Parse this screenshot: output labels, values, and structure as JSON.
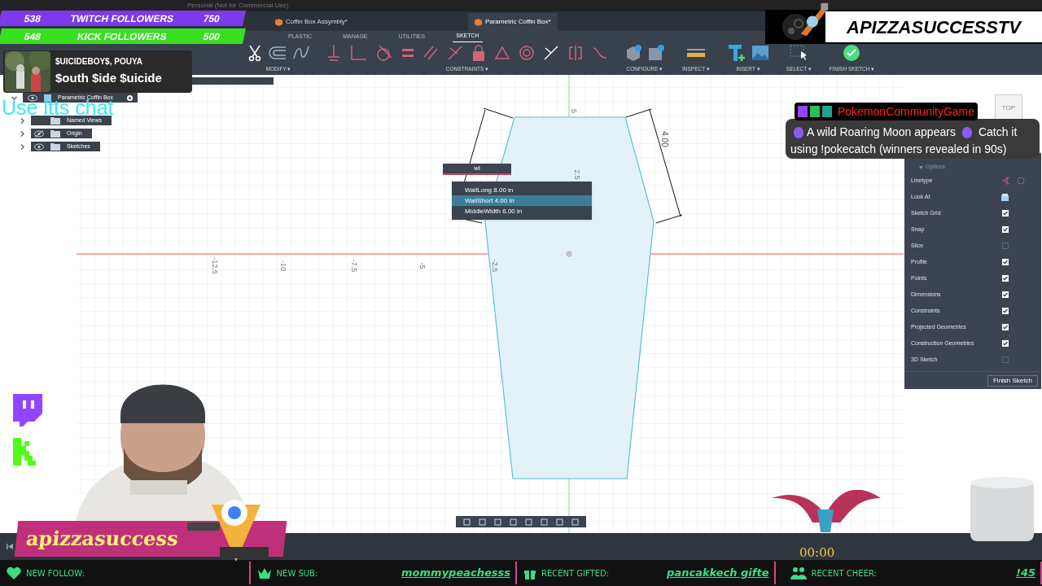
{
  "title_bar": {
    "text": "Personal (Not for Commercial Use)"
  },
  "document_tabs": [
    {
      "label": "Coffin Box Assymbly*",
      "selected": false
    },
    {
      "label": "Parametric Coffin Box*",
      "selected": true
    }
  ],
  "ribbon_tabs": [
    {
      "label": "PLASTIC",
      "selected": false
    },
    {
      "label": "MANAGE",
      "selected": false
    },
    {
      "label": "UTILITIES",
      "selected": false
    },
    {
      "label": "SKETCH",
      "selected": true
    }
  ],
  "ribbon_groups": [
    {
      "label": "MODIFY ▾",
      "kind": "modify"
    },
    {
      "label": "CONSTRAINTS ▾",
      "kind": "constraints"
    },
    {
      "label": "CONFIGURE ▾",
      "kind": "configure"
    },
    {
      "label": "INSPECT ▾",
      "kind": "inspect"
    },
    {
      "label": "INSERT ▾",
      "kind": "insert"
    },
    {
      "label": "SELECT ▾",
      "kind": "select"
    },
    {
      "label": "FINISH SKETCH ▾",
      "kind": "finish"
    }
  ],
  "browser": {
    "root": {
      "label": "Parametric Coffin Box",
      "visible": true,
      "expanded": true,
      "children": [
        {
          "label": "Named Views",
          "expanded": false
        },
        {
          "label": "Origin",
          "visible": false,
          "expanded": false
        },
        {
          "label": "Sketches",
          "visible": true,
          "expanded": false
        }
      ]
    }
  },
  "canvas": {
    "axis_labels": [
      "-12.5",
      "-10",
      "-7.5",
      "-5",
      "-2.5"
    ],
    "vertical_labels": [
      "5",
      "2.5"
    ],
    "dimension": "4.00",
    "search": {
      "value": "wl"
    },
    "suggestions": [
      {
        "name": "WallLong",
        "value": "8.00 in",
        "selected": false
      },
      {
        "name": "WallShort",
        "value": "4.00 in",
        "selected": true
      },
      {
        "name": "MiddleWidth",
        "value": "6.00 in",
        "selected": false
      }
    ]
  },
  "view_cube": {
    "label": "TOP"
  },
  "sketch_palette": {
    "section": "Options",
    "options": [
      {
        "label": "Linetype",
        "kind": "linetype"
      },
      {
        "label": "Look At",
        "kind": "lookat"
      },
      {
        "label": "Sketch Grid",
        "kind": "checkbox",
        "checked": true
      },
      {
        "label": "Snap",
        "kind": "checkbox",
        "checked": true
      },
      {
        "label": "Slice",
        "kind": "checkbox",
        "checked": false
      },
      {
        "label": "Profile",
        "kind": "checkbox",
        "checked": true
      },
      {
        "label": "Points",
        "kind": "checkbox",
        "checked": true
      },
      {
        "label": "Dimensions",
        "kind": "checkbox",
        "checked": true
      },
      {
        "label": "Constraints",
        "kind": "checkbox",
        "checked": true
      },
      {
        "label": "Projected Geometries",
        "kind": "checkbox",
        "checked": true
      },
      {
        "label": "Construction Geometries",
        "kind": "checkbox",
        "checked": true
      },
      {
        "label": "3D Sketch",
        "kind": "checkbox",
        "checked": false
      }
    ],
    "button": "Finish Sketch"
  },
  "timeline": {
    "time": "00:00"
  },
  "overlay": {
    "follower_bars": [
      {
        "current": "538",
        "label": "TWITCH FOLLOWERS",
        "goal": "750",
        "color": "#7c3aed"
      },
      {
        "current": "548",
        "label": "KICK FOLLOWERS",
        "goal": "500",
        "color": "#39e01f"
      }
    ],
    "now_playing": {
      "artist": "$UICIDEBOY$, POUYA",
      "title": "$outh $ide $uicide"
    },
    "tts_hint": "Use ltts chat",
    "chat": {
      "user": "PokemonCommunityGame",
      "message": "A wild Roaring Moon appears",
      "message_end": "Catch it using !pokecatch (winners revealed in 90s)"
    },
    "channel_banner": "APIZZASUCCESSTV",
    "name_banner": "apizzasuccess",
    "events": [
      {
        "kind": "follow",
        "label": "NEW FOLLOW:"
      },
      {
        "kind": "sub",
        "label": "NEW SUB:",
        "value": "mommypeachesss"
      },
      {
        "kind": "gifted",
        "label": "RECENT GIFTED:",
        "value": "pancakkech gifte"
      },
      {
        "kind": "cheer",
        "label": "RECENT CHEER:",
        "value": "!45"
      }
    ]
  }
}
